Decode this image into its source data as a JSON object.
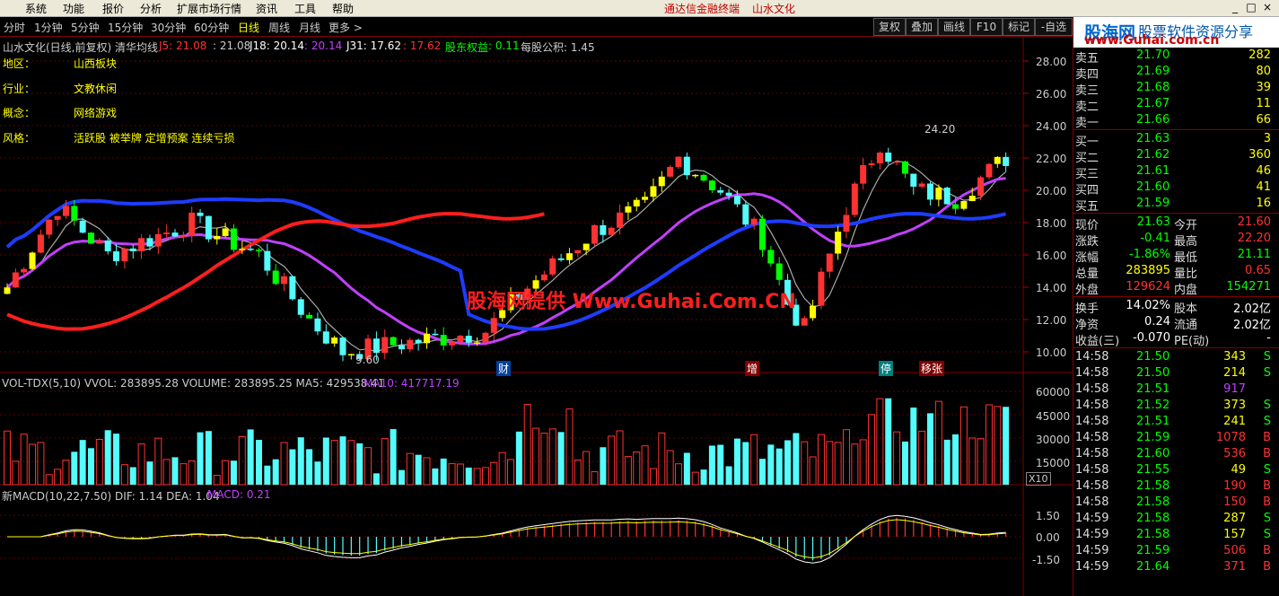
{
  "menubar": {
    "items": [
      "系统",
      "功能",
      "报价",
      "分析",
      "扩展市场行情",
      "资讯",
      "工具",
      "帮助"
    ],
    "center_text": "通达信金融终端",
    "center_stock": "山水文化",
    "win_controls": [
      "_",
      "□",
      "×"
    ]
  },
  "periodbar": {
    "periods": [
      "分时",
      "1分钟",
      "5分钟",
      "15分钟",
      "30分钟",
      "60分钟",
      "日线",
      "周线",
      "月线",
      "更多 >"
    ],
    "active": "日线",
    "tools": [
      "复权",
      "叠加",
      "画线",
      "F10",
      "标记",
      "-自选"
    ]
  },
  "chart": {
    "title": "山水文化(日线,前复权) 清华均线",
    "j5": "J5: 21.08",
    "j5b": ": 21.08",
    "j18": "J18: 20.14",
    "j18b": ": 20.14",
    "j31": "J31: 17.62",
    "j31b": ": 17.62",
    "equity_label": "股东权益",
    "equity_value": ": 0.11",
    "reserve": "每股公积: 1.45",
    "info": [
      {
        "label": "地区：",
        "value": "山西板块"
      },
      {
        "label": "行业：",
        "value": "文教休闲"
      },
      {
        "label": "概念：",
        "value": "网络游戏"
      },
      {
        "label": "风格：",
        "value": "活跃股 被举牌 定增预案 连续亏损"
      }
    ],
    "y_ticks": [
      "28.00",
      "26.00",
      "24.00",
      "22.00",
      "20.00",
      "18.00",
      "16.00",
      "14.00",
      "12.00",
      "10.00"
    ],
    "high_label": "24.20",
    "low_label": "9.60",
    "markers": [
      "财",
      "增",
      "停",
      "移张"
    ],
    "watermark": "股海网提供 Www.Guhai.Com.CN"
  },
  "volume": {
    "title": "VOL-TDX(5,10) VVOL: 283895.28  VOLUME: 283895.25  MA5: 429538.41",
    "ma10": "MA10: 417717.19",
    "y_ticks": [
      "60000",
      "45000",
      "30000",
      "15000"
    ],
    "unit": "X10"
  },
  "macd": {
    "title": "新MACD(10,22,7.50)  DIF: 1.14  DEA: 1.04",
    "macd_val": "MACD: 0.21",
    "y_ticks": [
      "1.50",
      "0.00",
      "-1.50"
    ]
  },
  "colors": {
    "up": "#ff3232",
    "down": "#54fcfc",
    "ma_blue": "#1e3cff",
    "ma_purple": "#c040ff",
    "ma_red": "#ff1e1e",
    "yellow": "#ffff00",
    "green": "#00ff00"
  },
  "logo": {
    "name": "股海网",
    "slogan": "股票软件资源分享",
    "url": "www.Guhai.com.cn"
  },
  "quote": {
    "asks": [
      {
        "label": "卖五",
        "price": "21.70",
        "vol": "282"
      },
      {
        "label": "卖四",
        "price": "21.69",
        "vol": "80"
      },
      {
        "label": "卖三",
        "price": "21.68",
        "vol": "39"
      },
      {
        "label": "卖二",
        "price": "21.67",
        "vol": "11"
      },
      {
        "label": "卖一",
        "price": "21.66",
        "vol": "66"
      }
    ],
    "bids": [
      {
        "label": "买一",
        "price": "21.63",
        "vol": "3"
      },
      {
        "label": "买二",
        "price": "21.62",
        "vol": "360"
      },
      {
        "label": "买三",
        "price": "21.61",
        "vol": "46"
      },
      {
        "label": "买四",
        "price": "21.60",
        "vol": "41"
      },
      {
        "label": "买五",
        "price": "21.59",
        "vol": "16"
      }
    ],
    "stats": [
      {
        "l1": "现价",
        "v1": "21.63",
        "l2": "今开",
        "v2": "21.60"
      },
      {
        "l1": "涨跌",
        "v1": "-0.41",
        "l2": "最高",
        "v2": "22.20"
      },
      {
        "l1": "涨幅",
        "v1": "-1.86%",
        "l2": "最低",
        "v2": "21.11"
      },
      {
        "l1": "总量",
        "v1": "283895",
        "l2": "量比",
        "v2": "0.65"
      },
      {
        "l1": "外盘",
        "v1": "129624",
        "l2": "内盘",
        "v2": "154271"
      }
    ],
    "extra": [
      {
        "l1": "换手",
        "v1": "14.02%",
        "l2": "股本",
        "v2": "2.02亿"
      },
      {
        "l1": "净资",
        "v1": "0.24",
        "l2": "流通",
        "v2": "2.02亿"
      },
      {
        "l1": "收益(三)",
        "v1": "-0.070",
        "l2": "PE(动)",
        "v2": "-"
      }
    ]
  },
  "ticks": [
    {
      "t": "14:58",
      "p": "21.50",
      "v": "343",
      "s": "S"
    },
    {
      "t": "14:58",
      "p": "21.50",
      "v": "214",
      "s": "S"
    },
    {
      "t": "14:58",
      "p": "21.51",
      "v": "917",
      "s": ""
    },
    {
      "t": "14:58",
      "p": "21.52",
      "v": "373",
      "s": "S"
    },
    {
      "t": "14:58",
      "p": "21.51",
      "v": "241",
      "s": "S"
    },
    {
      "t": "14:58",
      "p": "21.59",
      "v": "1078",
      "s": "B"
    },
    {
      "t": "14:58",
      "p": "21.60",
      "v": "536",
      "s": "B"
    },
    {
      "t": "14:58",
      "p": "21.55",
      "v": "49",
      "s": "S"
    },
    {
      "t": "14:58",
      "p": "21.58",
      "v": "190",
      "s": "B"
    },
    {
      "t": "14:58",
      "p": "21.58",
      "v": "150",
      "s": "B"
    },
    {
      "t": "14:59",
      "p": "21.58",
      "v": "287",
      "s": "S"
    },
    {
      "t": "14:59",
      "p": "21.58",
      "v": "157",
      "s": "S"
    },
    {
      "t": "14:59",
      "p": "21.59",
      "v": "506",
      "s": "B"
    },
    {
      "t": "14:59",
      "p": "21.64",
      "v": "371",
      "s": "B"
    }
  ]
}
